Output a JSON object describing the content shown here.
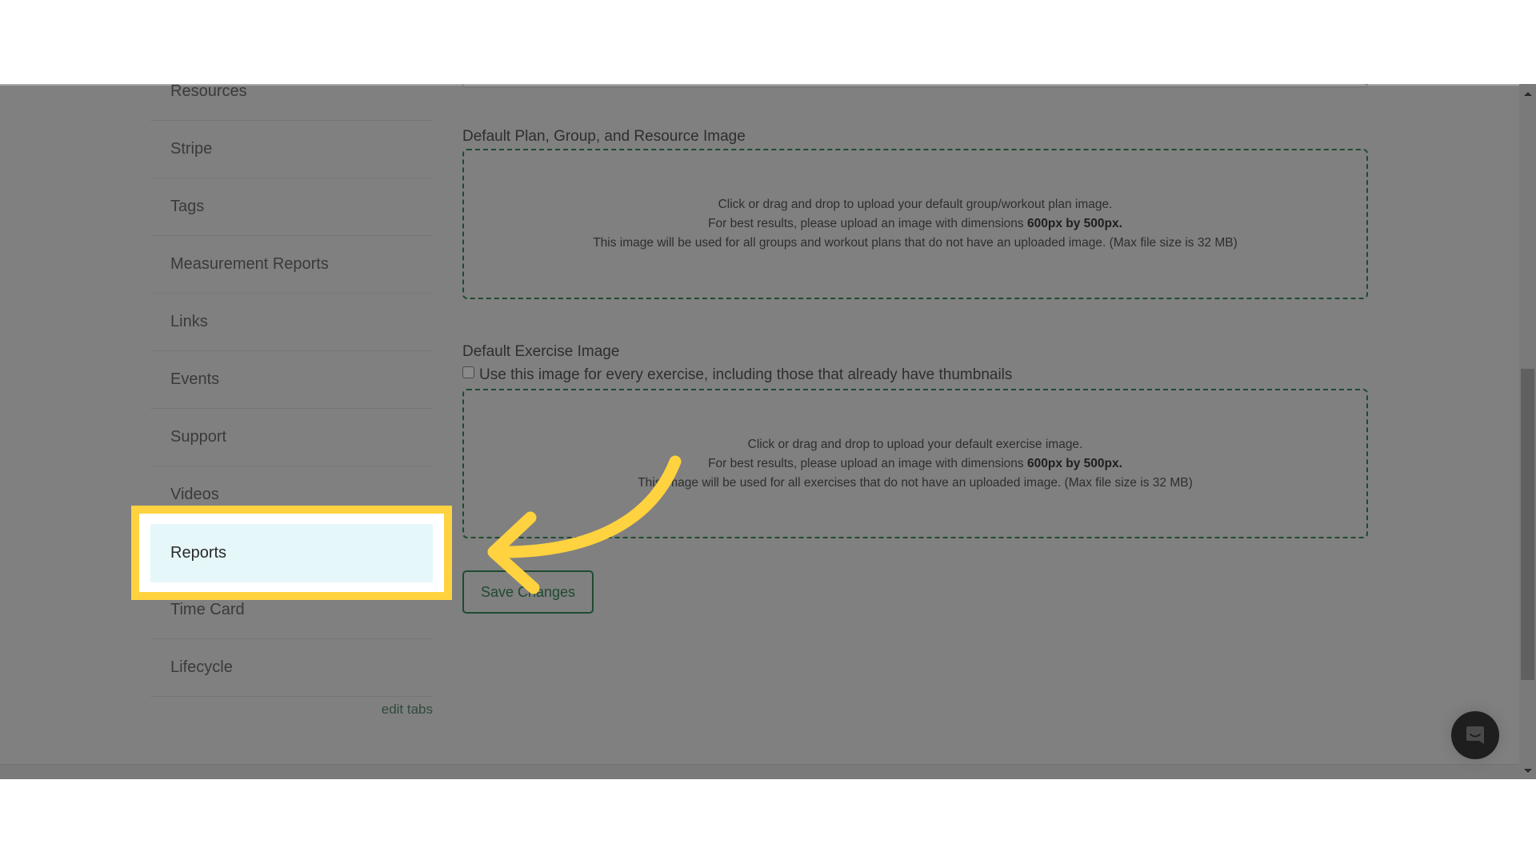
{
  "sidebar": {
    "items": [
      {
        "label": "Resources"
      },
      {
        "label": "Stripe"
      },
      {
        "label": "Tags"
      },
      {
        "label": "Measurement Reports"
      },
      {
        "label": "Links"
      },
      {
        "label": "Events"
      },
      {
        "label": "Support"
      },
      {
        "label": "Videos"
      },
      {
        "label": "Reports",
        "active": true
      },
      {
        "label": "Time Card"
      },
      {
        "label": "Lifecycle"
      }
    ],
    "edit_tabs_label": "edit tabs"
  },
  "form": {
    "plan_image": {
      "label": "Default Plan, Group, and Resource Image",
      "line1": "Click or drag and drop to upload your default group/workout plan image.",
      "line2_prefix": "For best results, please upload an image with dimensions ",
      "line2_bold": "600px by 500px",
      "line2_suffix": ".",
      "line3": "This image will be used for all groups and workout plans that do not have an uploaded image. (Max file size is 32 MB)"
    },
    "exercise_image": {
      "label": "Default Exercise Image",
      "checkbox_label": "Use this image for every exercise, including those that already have thumbnails",
      "checkbox_checked": false,
      "line1": "Click or drag and drop to upload your default exercise image.",
      "line2_prefix": "For best results, please upload an image with dimensions ",
      "line2_bold": "600px by 500px",
      "line2_suffix": ".",
      "line3": "This image will be used for all exercises that do not have an uploaded image. (Max file size is 32 MB)"
    },
    "save_label": "Save Changes"
  },
  "icons": {
    "chat": "chat-bubble-icon",
    "arrow": "curved-arrow-pointer-icon"
  },
  "colors": {
    "highlight": "#ffd23f",
    "active_item_bg": "#e6f7fa",
    "accent_green": "#1f4a31",
    "overlay": "#808080"
  }
}
